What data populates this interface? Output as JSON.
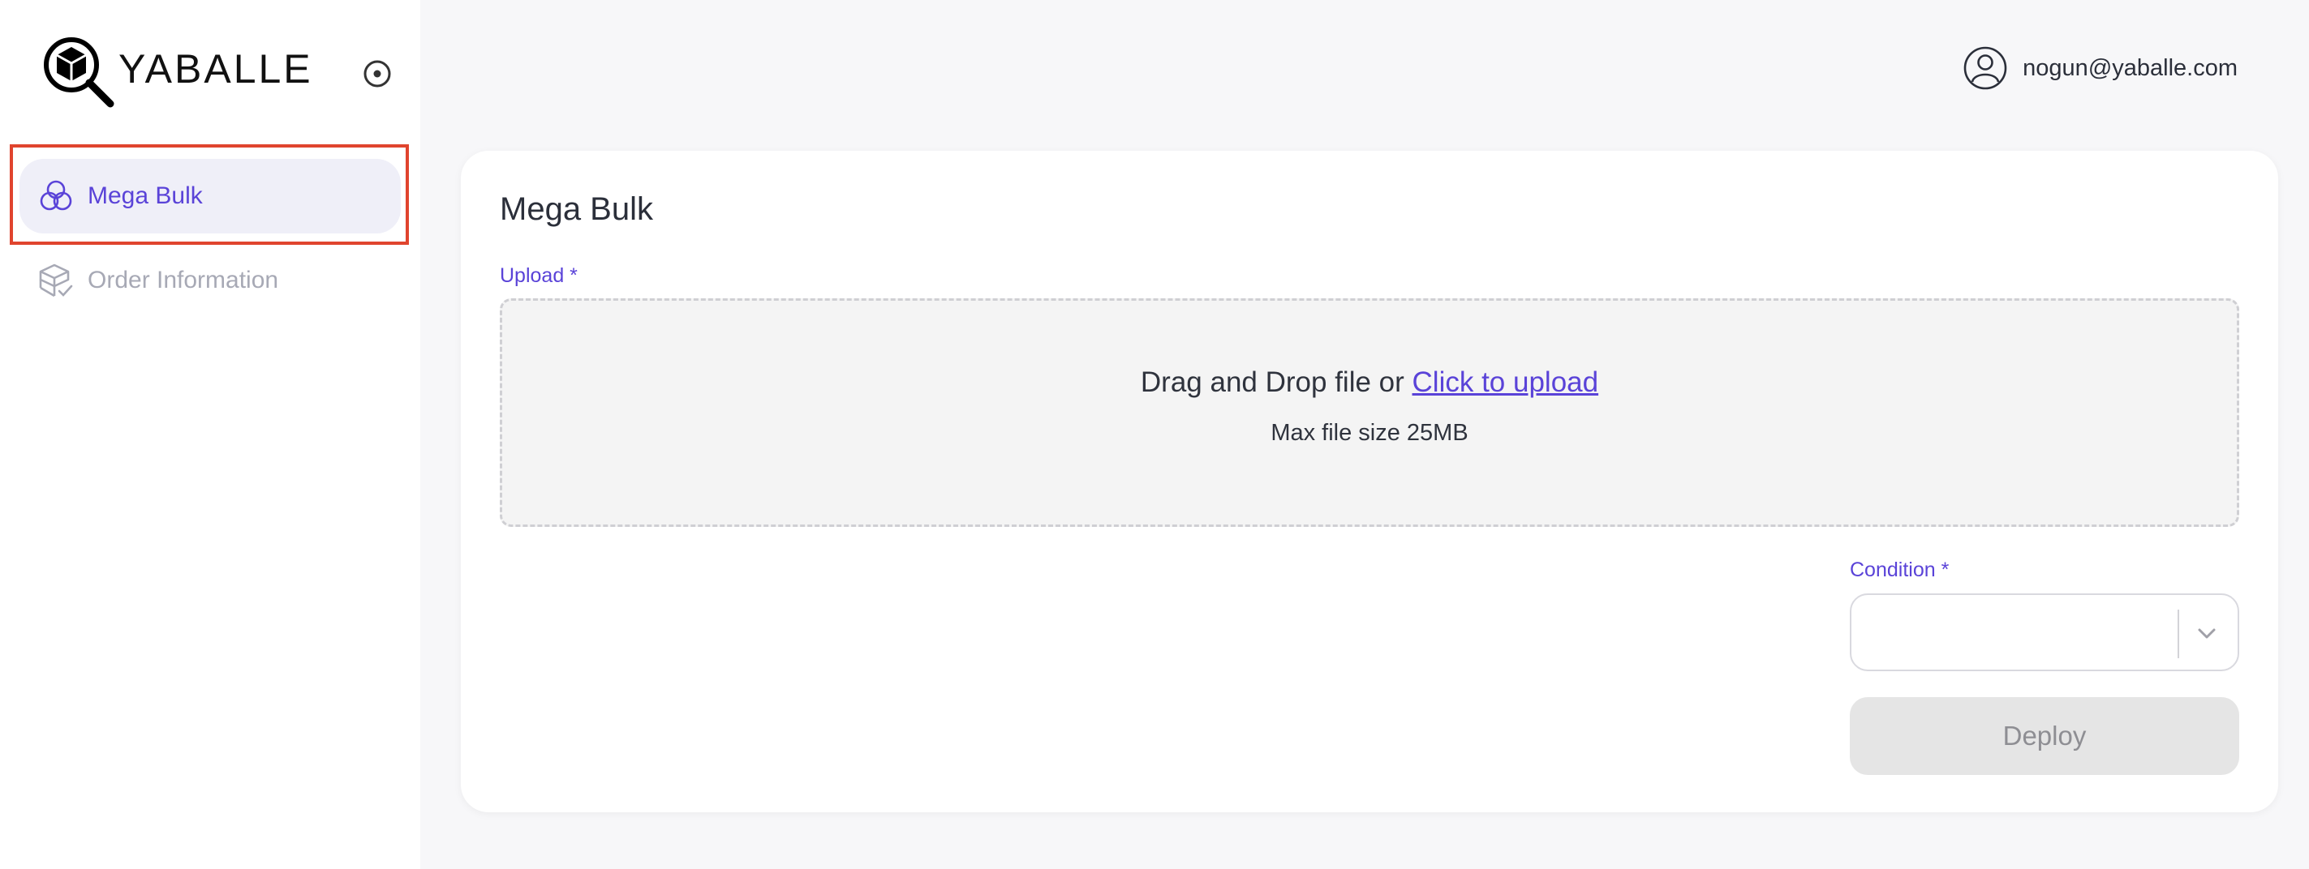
{
  "app": {
    "logo_text": "YABALLE"
  },
  "sidebar": {
    "items": [
      {
        "label": "Mega Bulk",
        "icon": "circles-icon",
        "active": true
      },
      {
        "label": "Order Information",
        "icon": "package-check-icon",
        "active": false
      }
    ]
  },
  "header": {
    "user_email": "nogun@yaballe.com"
  },
  "main": {
    "title": "Mega Bulk",
    "upload": {
      "label": "Upload *",
      "drop_text": "Drag and Drop file or ",
      "link_text": "Click to upload",
      "max_size_text": "Max file size 25MB"
    },
    "condition": {
      "label": "Condition *",
      "value": ""
    },
    "deploy_label": "Deploy"
  },
  "colors": {
    "accent": "#5a43d8",
    "highlight_outline": "#e0442e",
    "active_nav_bg": "#efeff8",
    "disabled_button_bg": "#e5e5e5"
  }
}
